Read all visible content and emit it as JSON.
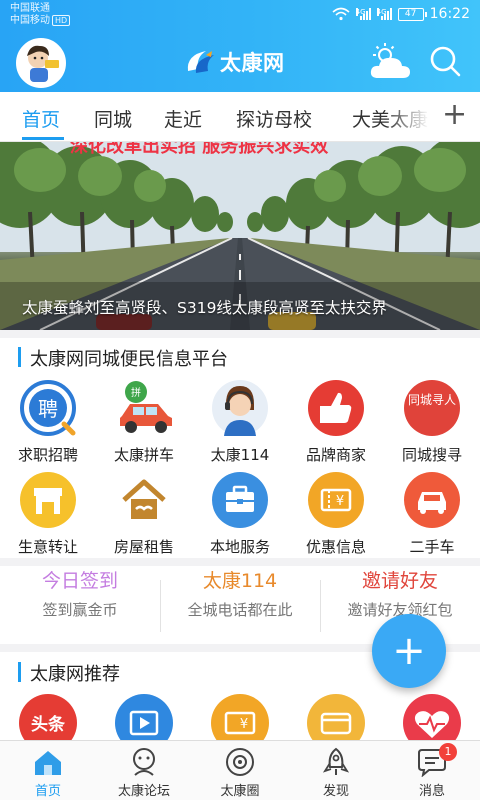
{
  "status_bar": {
    "carrier_1": "中国联通",
    "carrier_2": "中国移动",
    "carrier_2_badge": "HD",
    "network_1": "4G",
    "network_2": "4G",
    "battery": "47",
    "time": "16:22"
  },
  "header": {
    "logo_text": "太康网",
    "colors": {
      "brand": "#2aa7f5",
      "accent": "#1d9df0"
    }
  },
  "tabs": {
    "items": [
      "首页",
      "同城",
      "走近",
      "探访母校",
      "大美太康"
    ],
    "active_index": 0,
    "add_symbol": "+"
  },
  "banner": {
    "caption": "太康蚕蜂刘至高贤段、S319线太康段高贤至太扶交界",
    "top_text": "深化改革出实招 服务振兴求实效"
  },
  "services_section": {
    "title": "太康网同城便民信息平台",
    "items": [
      {
        "label": "求职招聘",
        "icon": "job-icon",
        "badge_text": "聘"
      },
      {
        "label": "太康拼车",
        "icon": "carpool-icon",
        "badge_text": "拼"
      },
      {
        "label": "太康114",
        "icon": "operator-icon"
      },
      {
        "label": "品牌商家",
        "icon": "thumbs-up-icon"
      },
      {
        "label": "同城搜寻",
        "icon": "people-search-icon",
        "badge_text": "同城寻人"
      },
      {
        "label": "生意转让",
        "icon": "shop-icon"
      },
      {
        "label": "房屋租售",
        "icon": "house-icon"
      },
      {
        "label": "本地服务",
        "icon": "toolbox-icon"
      },
      {
        "label": "优惠信息",
        "icon": "coupon-icon"
      },
      {
        "label": "二手车",
        "icon": "car-icon"
      }
    ]
  },
  "quick_actions": [
    {
      "title": "今日签到",
      "subtitle": "签到赢金币",
      "color": "#c47de0"
    },
    {
      "title": "太康114",
      "subtitle": "全城电话都在此",
      "color": "#e88a2c"
    },
    {
      "title": "邀请好友",
      "subtitle": "邀请好友领红包",
      "color": "#e0463c"
    }
  ],
  "fab": {
    "symbol": "+"
  },
  "recommend_section": {
    "title": "太康网推荐",
    "items": [
      {
        "icon": "headlines-icon",
        "badge_text": "头条"
      },
      {
        "icon": "video-icon"
      },
      {
        "icon": "coupon-icon"
      },
      {
        "icon": "card-icon"
      },
      {
        "icon": "health-icon"
      }
    ]
  },
  "bottom_nav": {
    "items": [
      {
        "label": "首页",
        "icon": "home-icon"
      },
      {
        "label": "太康论坛",
        "icon": "forum-icon"
      },
      {
        "label": "太康圈",
        "icon": "circle-icon"
      },
      {
        "label": "发现",
        "icon": "rocket-icon"
      },
      {
        "label": "消息",
        "icon": "message-icon",
        "badge": "1"
      }
    ],
    "active_index": 0
  }
}
